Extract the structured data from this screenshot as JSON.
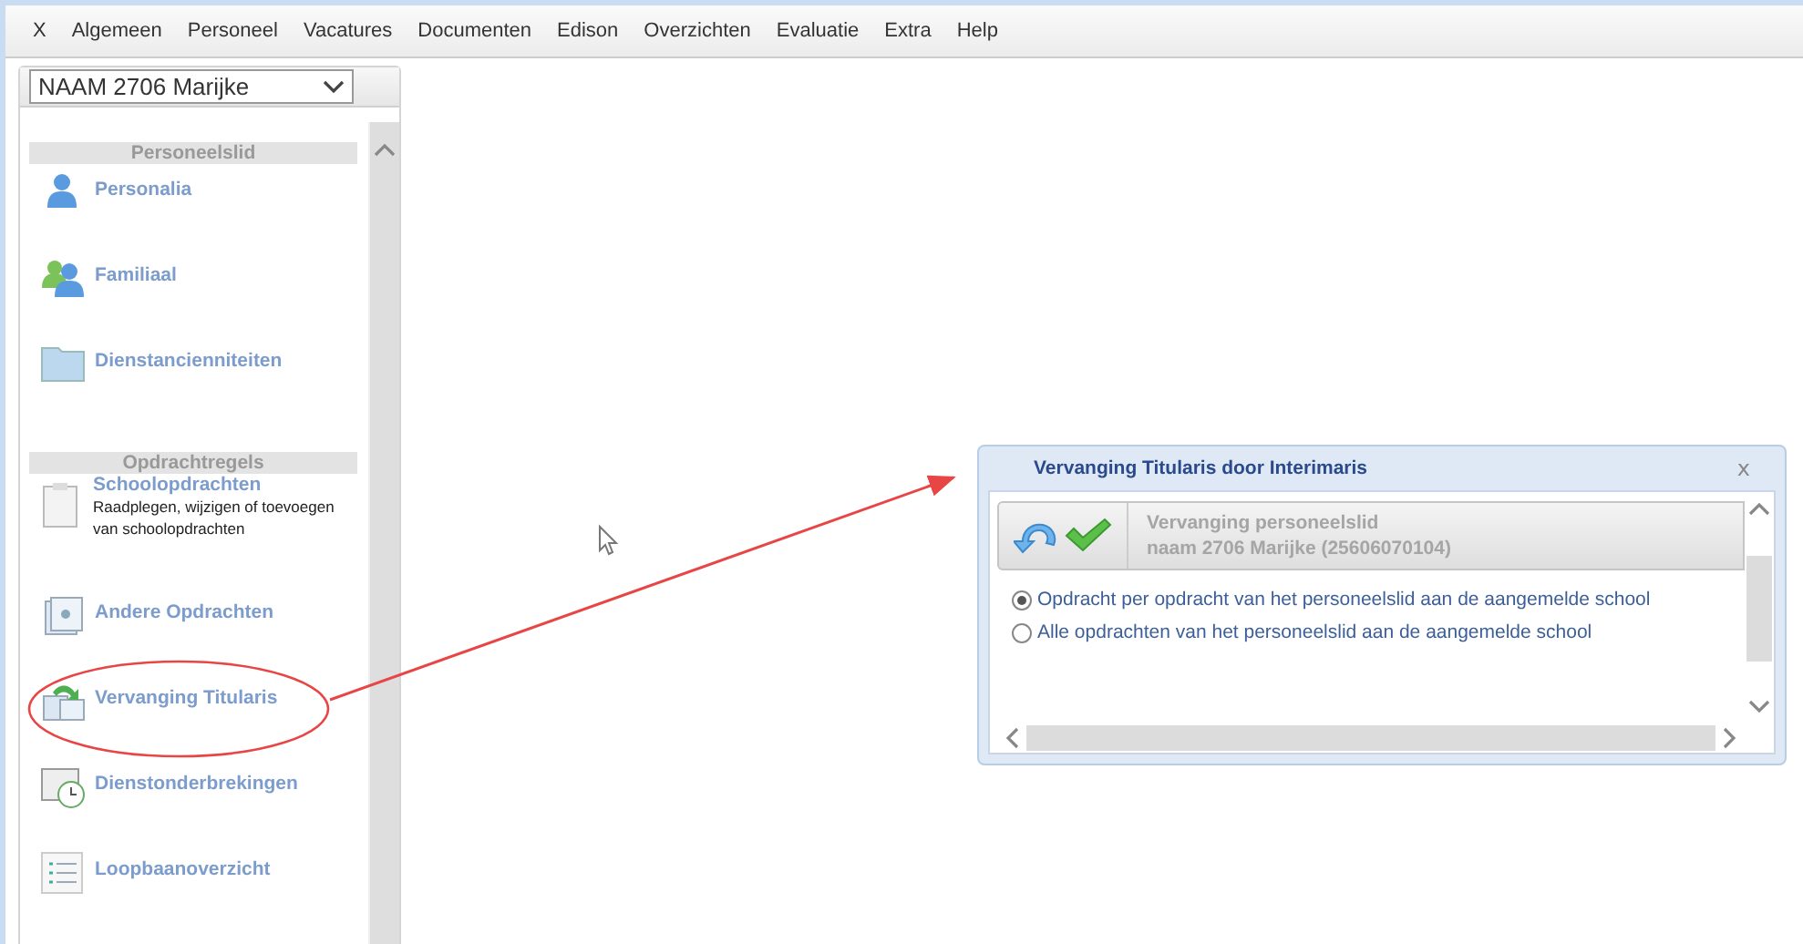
{
  "menu": [
    "X",
    "Algemeen",
    "Personeel",
    "Vacatures",
    "Documenten",
    "Edison",
    "Overzichten",
    "Evaluatie",
    "Extra",
    "Help"
  ],
  "person_select": {
    "value": "NAAM 2706 Marijke"
  },
  "sidebar": {
    "sections": [
      {
        "title": "Personeelslid",
        "items": [
          {
            "label": "Personalia"
          },
          {
            "label": "Familiaal"
          },
          {
            "label": "Dienstancienniteiten"
          }
        ]
      },
      {
        "title": "Opdrachtregels",
        "items": [
          {
            "label": "Schoolopdrachten",
            "description": "Raadplegen, wijzigen of toevoegen van schoolopdrachten"
          },
          {
            "label": "Andere Opdrachten"
          },
          {
            "label": "Vervanging Titularis"
          },
          {
            "label": "Dienstonderbrekingen"
          },
          {
            "label": "Loopbaanoverzicht"
          }
        ]
      }
    ]
  },
  "dialog": {
    "title": "Vervanging Titularis door Interimaris",
    "close": "x",
    "heading": "Vervanging personeelslid",
    "subheading": "naam 2706 Marijke (25606070104)",
    "options": [
      {
        "label": "Opdracht per opdracht van het personeelslid aan de aangemelde school",
        "selected": true
      },
      {
        "label": "Alle opdrachten van het personeelslid aan de aangemelde school",
        "selected": false
      }
    ]
  }
}
